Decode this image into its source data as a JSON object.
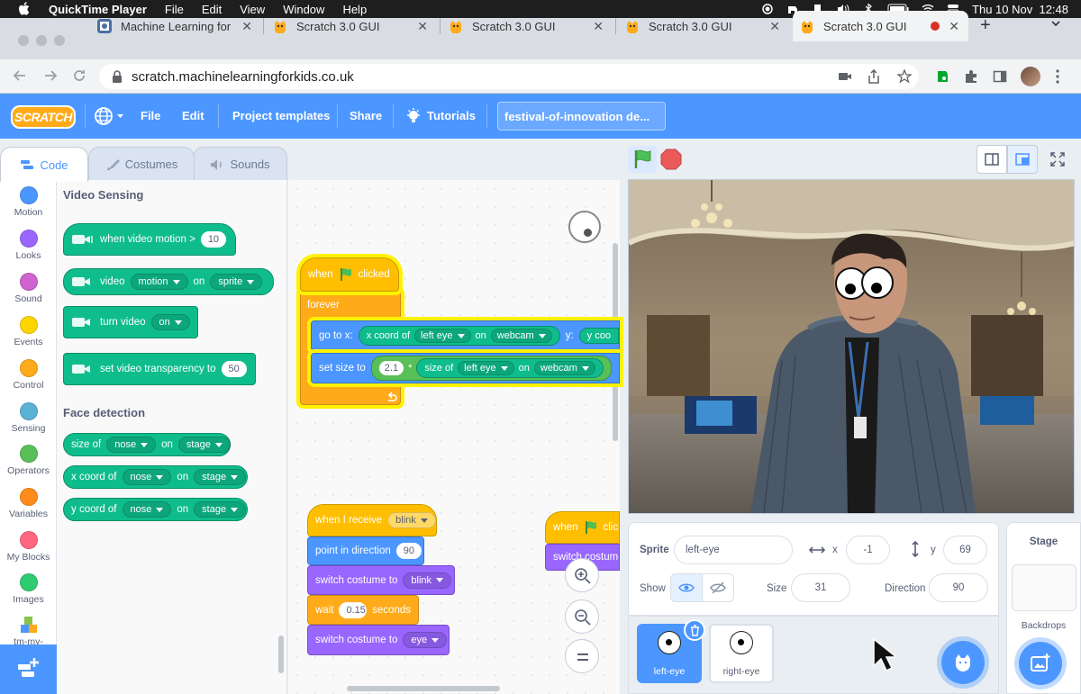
{
  "menubar": {
    "app_name": "QuickTime Player",
    "items": [
      "File",
      "Edit",
      "View",
      "Window",
      "Help"
    ],
    "clock": "Thu 10 Nov  12:48"
  },
  "browser": {
    "tabs": [
      {
        "title": "Machine Learning for K"
      },
      {
        "title": "Scratch 3.0 GUI"
      },
      {
        "title": "Scratch 3.0 GUI"
      },
      {
        "title": "Scratch 3.0 GUI"
      },
      {
        "title": "Scratch 3.0 GUI"
      }
    ],
    "url": "scratch.machinelearningforkids.co.uk"
  },
  "scratch_menu": {
    "logo": "SCRATCH",
    "file": "File",
    "edit": "Edit",
    "templates": "Project templates",
    "share": "Share",
    "tutorials": "Tutorials",
    "project_title": "festival-of-innovation de..."
  },
  "editor_tabs": {
    "code": "Code",
    "costumes": "Costumes",
    "sounds": "Sounds"
  },
  "categories": [
    {
      "label": "Motion",
      "color": "#4c97ff"
    },
    {
      "label": "Looks",
      "color": "#9966ff"
    },
    {
      "label": "Sound",
      "color": "#cf63cf"
    },
    {
      "label": "Events",
      "color": "#ffd500"
    },
    {
      "label": "Control",
      "color": "#ffab19"
    },
    {
      "label": "Sensing",
      "color": "#5cb1d6"
    },
    {
      "label": "Operators",
      "color": "#59c059"
    },
    {
      "label": "Variables",
      "color": "#ff8c1a"
    },
    {
      "label": "My Blocks",
      "color": "#ff6680"
    },
    {
      "label": "Images",
      "color": "#2ecc71"
    },
    {
      "label": "tm-my-",
      "color": "#8bc34a"
    }
  ],
  "palette": {
    "video_title": "Video Sensing",
    "when_motion": "when video motion >",
    "when_motion_val": "10",
    "video": "video",
    "motion": "motion",
    "on": "on",
    "sprite": "sprite",
    "turn_video": "turn video",
    "turn_video_val": "on",
    "set_transparency": "set video transparency to",
    "transparency_val": "50",
    "face_title": "Face detection",
    "size_of": "size of",
    "x_coord_of": "x coord of",
    "y_coord_of": "y coord of",
    "nose": "nose",
    "stage": "stage"
  },
  "script1": {
    "when": "when",
    "clicked": "clicked",
    "forever": "forever",
    "goto_x": "go to x:",
    "x_coord_of": "x coord of",
    "left_eye": "left eye",
    "on": "on",
    "webcam": "webcam",
    "y": "y:",
    "y_partial": "y coo",
    "set_size": "set size to",
    "factor": "2.1",
    "times": "*",
    "size_of": "size of"
  },
  "script2": {
    "when_receive": "when I receive",
    "message": "blink",
    "point_dir": "point in direction",
    "dir_val": "90",
    "switch_costume": "switch costume to",
    "costume1": "blink",
    "wait": "wait",
    "wait_val": "0.15",
    "seconds": "seconds",
    "costume2": "eye"
  },
  "script3": {
    "when": "when",
    "clicked_partial": "click",
    "switch_partial": "switch costume"
  },
  "sprite_info": {
    "sprite_label": "Sprite",
    "sprite_name": "left-eye",
    "x_label": "x",
    "x_val": "-1",
    "y_label": "y",
    "y_val": "69",
    "show_label": "Show",
    "size_label": "Size",
    "size_val": "31",
    "direction_label": "Direction",
    "direction_val": "90"
  },
  "sprites": [
    {
      "name": "left-eye",
      "selected": true
    },
    {
      "name": "right-eye",
      "selected": false
    }
  ],
  "stage_panel": {
    "title": "Stage",
    "backdrops": "Backdrops"
  }
}
